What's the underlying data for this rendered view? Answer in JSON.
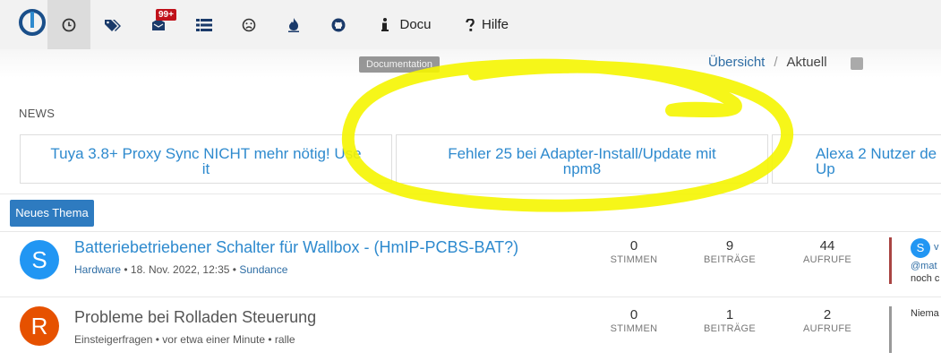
{
  "nav": {
    "items": [
      {
        "name": "recent-icon"
      },
      {
        "name": "tags-icon"
      },
      {
        "name": "inbox-icon"
      },
      {
        "name": "list-icon"
      },
      {
        "name": "unread-icon"
      },
      {
        "name": "popular-icon"
      },
      {
        "name": "github-icon"
      }
    ],
    "badge": "99+",
    "docu_label": "Docu",
    "hilfe_label": "Hilfe",
    "tooltip": "Documentation"
  },
  "breadcrumb": {
    "overview": "Übersicht",
    "separator": "/",
    "current": "Aktuell"
  },
  "news": {
    "label": "NEWS",
    "cards": [
      {
        "text": "Tuya 3.8+ Proxy Sync NICHT mehr nötig! Use it"
      },
      {
        "text": "Fehler 25 bei Adapter-Install/Update mit npm8"
      },
      {
        "text": "Alexa 2 Nutzer de Up"
      }
    ]
  },
  "new_topic_button": "Neues Thema",
  "topics": [
    {
      "avatar": "S",
      "avatar_color": "#2196f3",
      "title": "Batteriebetriebener Schalter für Wallbox - (HmIP-PCBS-BAT?)",
      "category": "Hardware",
      "dot1": "•",
      "time": "18. Nov. 2022, 12:35",
      "dot2": "•",
      "user": "Sundance",
      "votes": "0",
      "votes_label": "STIMMEN",
      "posts": "9",
      "posts_label": "BEITRÄGE",
      "views": "44",
      "views_label": "AUFRUFE",
      "last_avatar": "S",
      "last_user": "v",
      "last_line1": "@mat",
      "last_line2": "noch c",
      "bar_color": "#a94442"
    },
    {
      "avatar": "R",
      "avatar_color": "#e65100",
      "title": "Probleme bei Rolladen Steuerung",
      "category": "Einsteigerfragen",
      "dot1": "•",
      "time": "vor etwa einer Minute",
      "dot2": "•",
      "user": "ralle",
      "votes": "0",
      "votes_label": "STIMMEN",
      "posts": "1",
      "posts_label": "BEITRÄGE",
      "views": "2",
      "views_label": "AUFRUFE",
      "last_line1": "Niema",
      "bar_color": "#999999"
    }
  ],
  "highlight_color": "#f5f500"
}
